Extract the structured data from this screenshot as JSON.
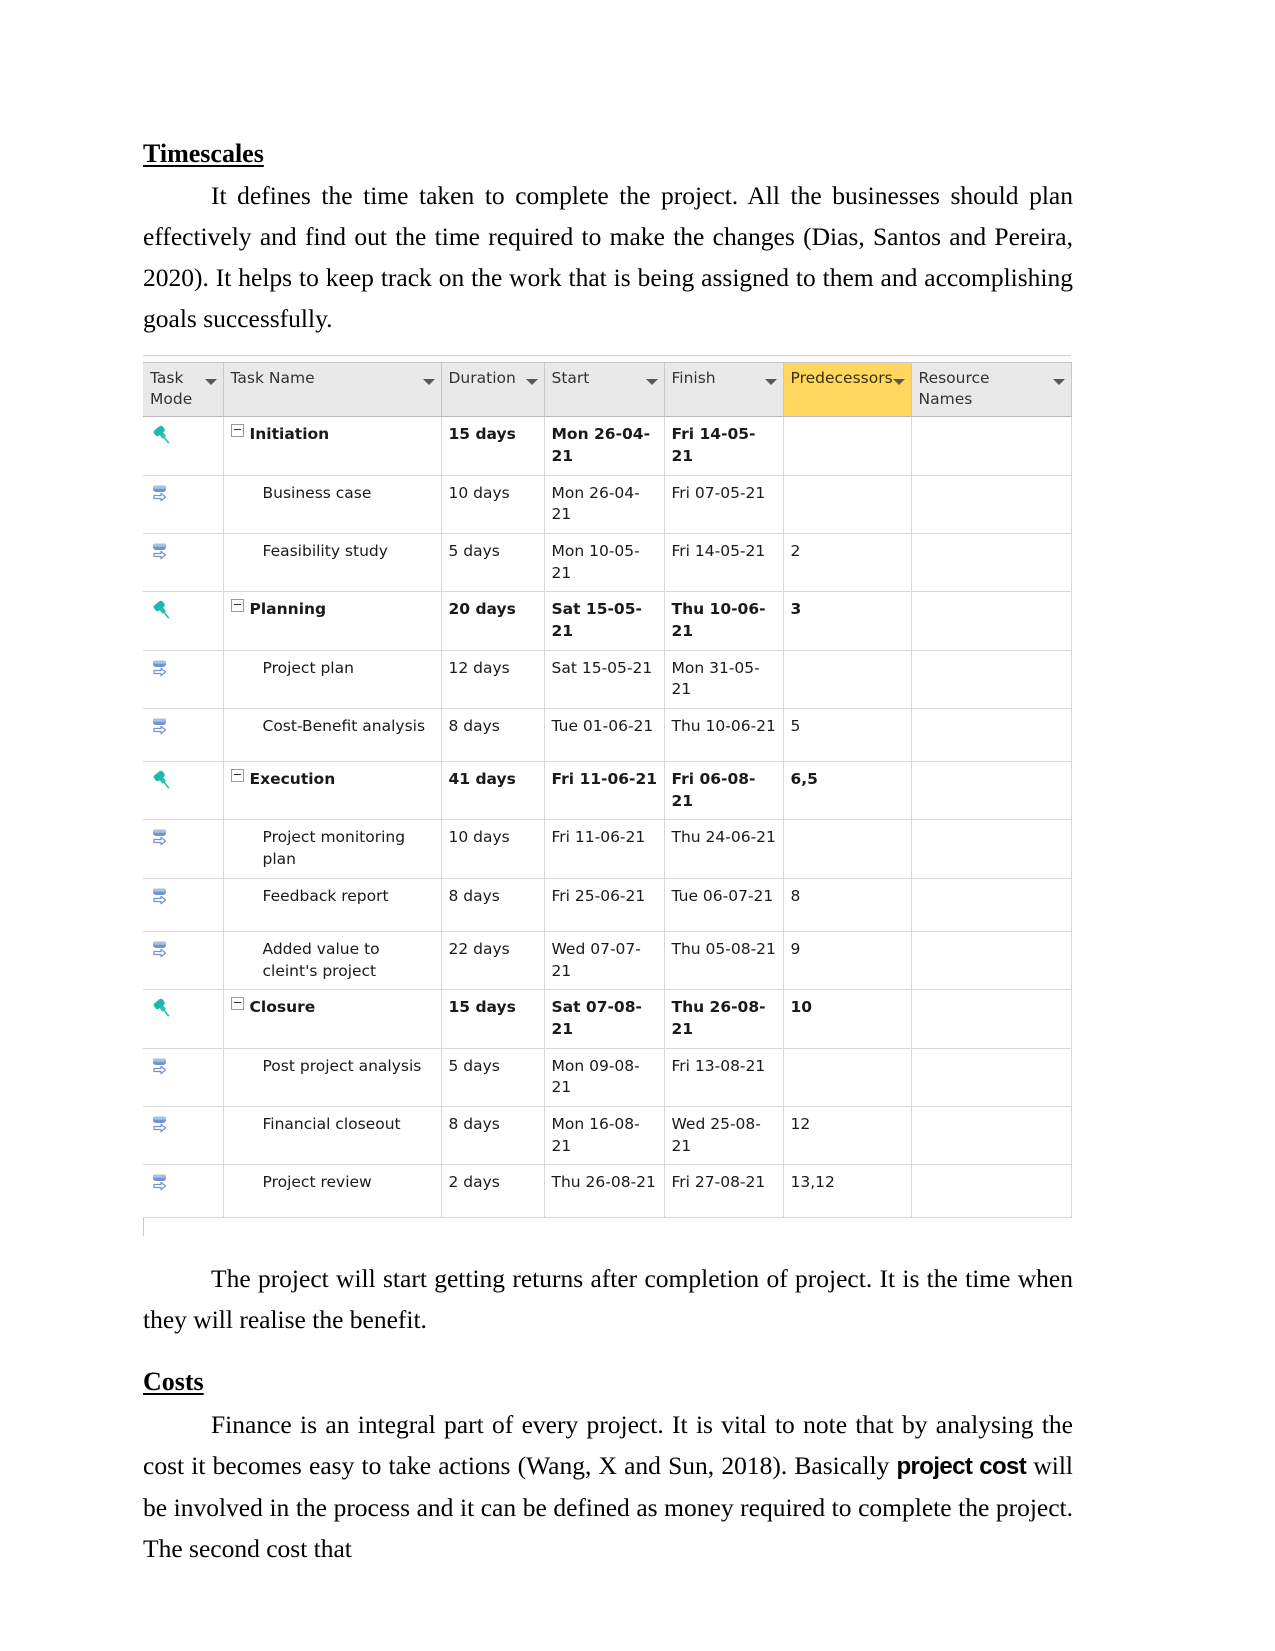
{
  "document": {
    "section1_heading": "Timescales",
    "section1_paragraph": "It defines the time taken to complete the project. All the businesses should plan effectively and find out the time required to make the changes (Dias, Santos and Pereira, 2020). It helps to keep track on the work that is being assigned to them and accomplishing goals successfully.",
    "after_table_paragraph": "The project will start getting returns after completion of project. It is the time when they will realise the benefit.",
    "section2_heading": "Costs ",
    "section2_paragraph_part1": "Finance is an integral part of every project. It is vital to note that by analysing the cost it becomes easy to take actions (Wang, X and Sun, 2018). Basically ",
    "section2_bold_term": "project cost",
    "section2_paragraph_part2": " will be involved in the process and it can be defined as money required to complete the project. The second cost that"
  },
  "gantt": {
    "highlight_color": "#ffd75e",
    "header_background": "#e9e9e9",
    "pin_icon_color": "#1fb8ac",
    "auto_icon_color": "#6f94d1",
    "columns": [
      {
        "key": "task_mode",
        "label": "Task Mode",
        "highlighted": false,
        "has_filter": true
      },
      {
        "key": "task_name",
        "label": "Task Name",
        "highlighted": false,
        "has_filter": true
      },
      {
        "key": "duration",
        "label": "Duration",
        "highlighted": false,
        "has_filter": true
      },
      {
        "key": "start",
        "label": "Start",
        "highlighted": false,
        "has_filter": true
      },
      {
        "key": "finish",
        "label": "Finish",
        "highlighted": false,
        "has_filter": true
      },
      {
        "key": "predecessors",
        "label": "Predecessors",
        "highlighted": true,
        "has_filter": true
      },
      {
        "key": "resource_names",
        "label": "Resource Names",
        "highlighted": false,
        "has_filter": true
      }
    ],
    "rows": [
      {
        "id": 1,
        "mode_icon": "pin-icon",
        "summary": true,
        "name": "Initiation",
        "duration": "15 days",
        "start": "Mon 26-04-21",
        "finish": "Fri 14-05-21",
        "predecessors": "",
        "resource_names": ""
      },
      {
        "id": 2,
        "mode_icon": "auto-schedule-icon",
        "summary": false,
        "name": "Business case",
        "duration": "10 days",
        "start": "Mon 26-04-21",
        "finish": "Fri 07-05-21",
        "predecessors": "",
        "resource_names": ""
      },
      {
        "id": 3,
        "mode_icon": "auto-schedule-icon",
        "summary": false,
        "name": "Feasibility study",
        "duration": "5 days",
        "start": "Mon 10-05-21",
        "finish": "Fri 14-05-21",
        "predecessors": "2",
        "resource_names": ""
      },
      {
        "id": 4,
        "mode_icon": "pin-icon",
        "summary": true,
        "name": "Planning",
        "duration": "20 days",
        "start": "Sat 15-05-21",
        "finish": "Thu 10-06-21",
        "predecessors": "3",
        "resource_names": ""
      },
      {
        "id": 5,
        "mode_icon": "auto-schedule-icon",
        "summary": false,
        "name": "Project plan",
        "duration": "12 days",
        "start": "Sat 15-05-21",
        "finish": "Mon 31-05-21",
        "predecessors": "",
        "resource_names": ""
      },
      {
        "id": 6,
        "mode_icon": "auto-schedule-icon",
        "summary": false,
        "name": "Cost-Benefit analysis",
        "duration": "8 days",
        "start": "Tue 01-06-21",
        "finish": "Thu 10-06-21",
        "predecessors": "5",
        "resource_names": ""
      },
      {
        "id": 7,
        "mode_icon": "pin-icon",
        "summary": true,
        "name": "Execution",
        "duration": "41 days",
        "start": "Fri 11-06-21",
        "finish": "Fri 06-08-21",
        "predecessors": "6,5",
        "resource_names": ""
      },
      {
        "id": 8,
        "mode_icon": "auto-schedule-icon",
        "summary": false,
        "name": "Project monitoring plan",
        "duration": "10 days",
        "start": "Fri 11-06-21",
        "finish": "Thu 24-06-21",
        "predecessors": "",
        "resource_names": ""
      },
      {
        "id": 9,
        "mode_icon": "auto-schedule-icon",
        "summary": false,
        "name": "Feedback report",
        "duration": "8 days",
        "start": "Fri 25-06-21",
        "finish": "Tue 06-07-21",
        "predecessors": "8",
        "resource_names": ""
      },
      {
        "id": 10,
        "mode_icon": "auto-schedule-icon",
        "summary": false,
        "name": "Added value to cleint's project",
        "duration": "22 days",
        "start": "Wed 07-07-21",
        "finish": "Thu 05-08-21",
        "predecessors": "9",
        "resource_names": ""
      },
      {
        "id": 11,
        "mode_icon": "pin-icon",
        "summary": true,
        "name": "Closure",
        "duration": "15 days",
        "start": "Sat 07-08-21",
        "finish": "Thu 26-08-21",
        "predecessors": "10",
        "resource_names": ""
      },
      {
        "id": 12,
        "mode_icon": "auto-schedule-icon",
        "summary": false,
        "name": "Post project analysis",
        "duration": "5 days",
        "start": "Mon 09-08-21",
        "finish": "Fri 13-08-21",
        "predecessors": "",
        "resource_names": ""
      },
      {
        "id": 13,
        "mode_icon": "auto-schedule-icon",
        "summary": false,
        "name": "Financial closeout",
        "duration": "8 days",
        "start": "Mon 16-08-21",
        "finish": "Wed 25-08-21",
        "predecessors": "12",
        "resource_names": ""
      },
      {
        "id": 14,
        "mode_icon": "auto-schedule-icon",
        "summary": false,
        "name": "Project review",
        "duration": "2 days",
        "start": "Thu 26-08-21",
        "finish": "Fri 27-08-21",
        "predecessors": "13,12",
        "resource_names": ""
      }
    ]
  }
}
